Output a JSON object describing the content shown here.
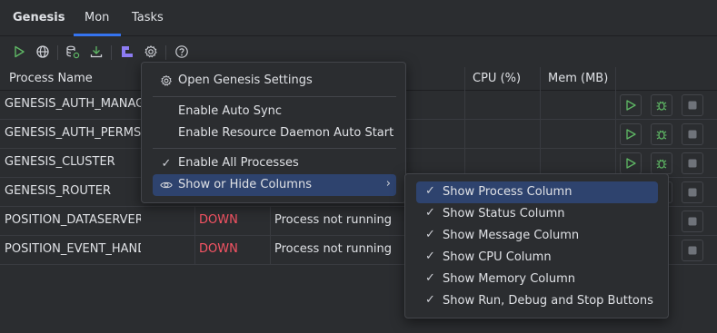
{
  "tabbar": {
    "title": "Genesis",
    "tabs": [
      {
        "label": "Mon"
      },
      {
        "label": "Tasks"
      }
    ],
    "active_tab": "Mon"
  },
  "toolbar": {
    "buttons": [
      {
        "icon": "run-all-icon"
      },
      {
        "icon": "globe-icon"
      },
      {
        "icon": "database-sync-icon"
      },
      {
        "icon": "download-icon"
      },
      {
        "icon": "genesis-logo-icon"
      },
      {
        "icon": "gear-icon"
      },
      {
        "icon": "help-icon"
      }
    ]
  },
  "table": {
    "columns": [
      "Process Name",
      "CPU (%)",
      "Mem (MB)"
    ],
    "rows": [
      {
        "name": "GENESIS_AUTH_MANAGER",
        "status": "",
        "message": ""
      },
      {
        "name": "GENESIS_AUTH_PERMS",
        "status": "",
        "message": ""
      },
      {
        "name": "GENESIS_CLUSTER",
        "status": "",
        "message": ""
      },
      {
        "name": "GENESIS_ROUTER",
        "status": "",
        "message": ""
      },
      {
        "name": "POSITION_DATASERVER",
        "status": "DOWN",
        "message": "Process not running"
      },
      {
        "name": "POSITION_EVENT_HANDLER",
        "status": "DOWN",
        "message": "Process not running"
      }
    ]
  },
  "menu": {
    "items": [
      {
        "label": "Open Genesis Settings",
        "icon": "gear-icon",
        "checked": false
      },
      {
        "label": "Enable Auto Sync",
        "checked": false
      },
      {
        "label": "Enable Resource Daemon Auto Start",
        "checked": false
      },
      {
        "label": "Enable All Processes",
        "checked": true
      },
      {
        "label": "Show or Hide Columns",
        "icon": "eye-icon",
        "has_submenu": true,
        "selected": true
      }
    ]
  },
  "submenu": {
    "items": [
      {
        "label": "Show Process Column",
        "checked": true,
        "selected": true
      },
      {
        "label": "Show Status Column",
        "checked": true
      },
      {
        "label": "Show Message Column",
        "checked": true
      },
      {
        "label": "Show CPU Column",
        "checked": true
      },
      {
        "label": "Show Memory Column",
        "checked": true
      },
      {
        "label": "Show Run, Debug and Stop Buttons",
        "checked": true
      }
    ]
  },
  "colors": {
    "background": "#2b2d30",
    "accent": "#3574f0",
    "selection": "#2e436e",
    "status_down": "#f75464",
    "run_green": "#5fb865"
  }
}
